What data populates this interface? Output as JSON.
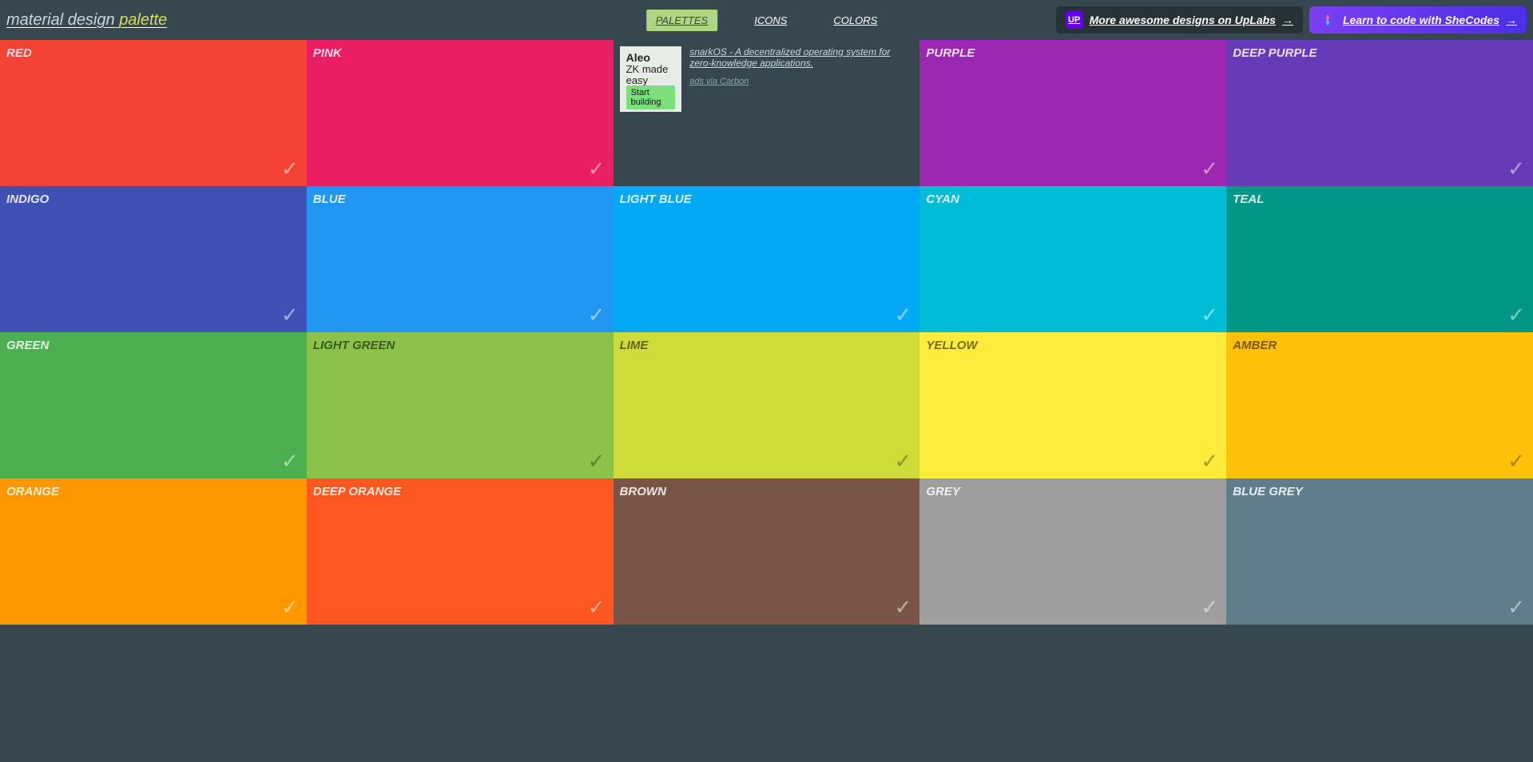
{
  "logo": {
    "part1": "material design",
    "part2": "palette"
  },
  "nav": {
    "palettes": "PALETTES",
    "icons": "ICONS",
    "colors": "COLORS"
  },
  "promo": {
    "uplabs": {
      "icon": "UP",
      "text": "More awesome designs on UpLabs"
    },
    "shecodes": {
      "text": "Learn to code with SheCodes"
    }
  },
  "ad": {
    "brand": "Aleo",
    "tagline": "ZK made easy",
    "cta": "Start building",
    "copy": "snarkOS - A decentralized operating system for zero-knowledge applications.",
    "via": "ads via Carbon"
  },
  "tiles": [
    {
      "name": "RED",
      "bg": "#f44336",
      "text": "light"
    },
    {
      "name": "PINK",
      "bg": "#e91e63",
      "text": "light"
    },
    {
      "name": "PURPLE",
      "bg": "#9c27b0",
      "text": "light"
    },
    {
      "name": "DEEP PURPLE",
      "bg": "#673ab7",
      "text": "light"
    },
    {
      "name": "INDIGO",
      "bg": "#3f51b5",
      "text": "light"
    },
    {
      "name": "BLUE",
      "bg": "#2196f3",
      "text": "light"
    },
    {
      "name": "LIGHT BLUE",
      "bg": "#03a9f4",
      "text": "light"
    },
    {
      "name": "CYAN",
      "bg": "#00bcd4",
      "text": "light"
    },
    {
      "name": "TEAL",
      "bg": "#009688",
      "text": "light"
    },
    {
      "name": "GREEN",
      "bg": "#4caf50",
      "text": "light"
    },
    {
      "name": "LIGHT GREEN",
      "bg": "#8bc34a",
      "text": "dark"
    },
    {
      "name": "LIME",
      "bg": "#cddc39",
      "text": "dark"
    },
    {
      "name": "YELLOW",
      "bg": "#ffeb3b",
      "text": "dark"
    },
    {
      "name": "AMBER",
      "bg": "#ffc107",
      "text": "dark"
    },
    {
      "name": "ORANGE",
      "bg": "#ff9800",
      "text": "light"
    },
    {
      "name": "DEEP ORANGE",
      "bg": "#ff5722",
      "text": "light"
    },
    {
      "name": "BROWN",
      "bg": "#795548",
      "text": "light"
    },
    {
      "name": "GREY",
      "bg": "#9e9e9e",
      "text": "light"
    },
    {
      "name": "BLUE GREY",
      "bg": "#607d8b",
      "text": "light"
    }
  ]
}
